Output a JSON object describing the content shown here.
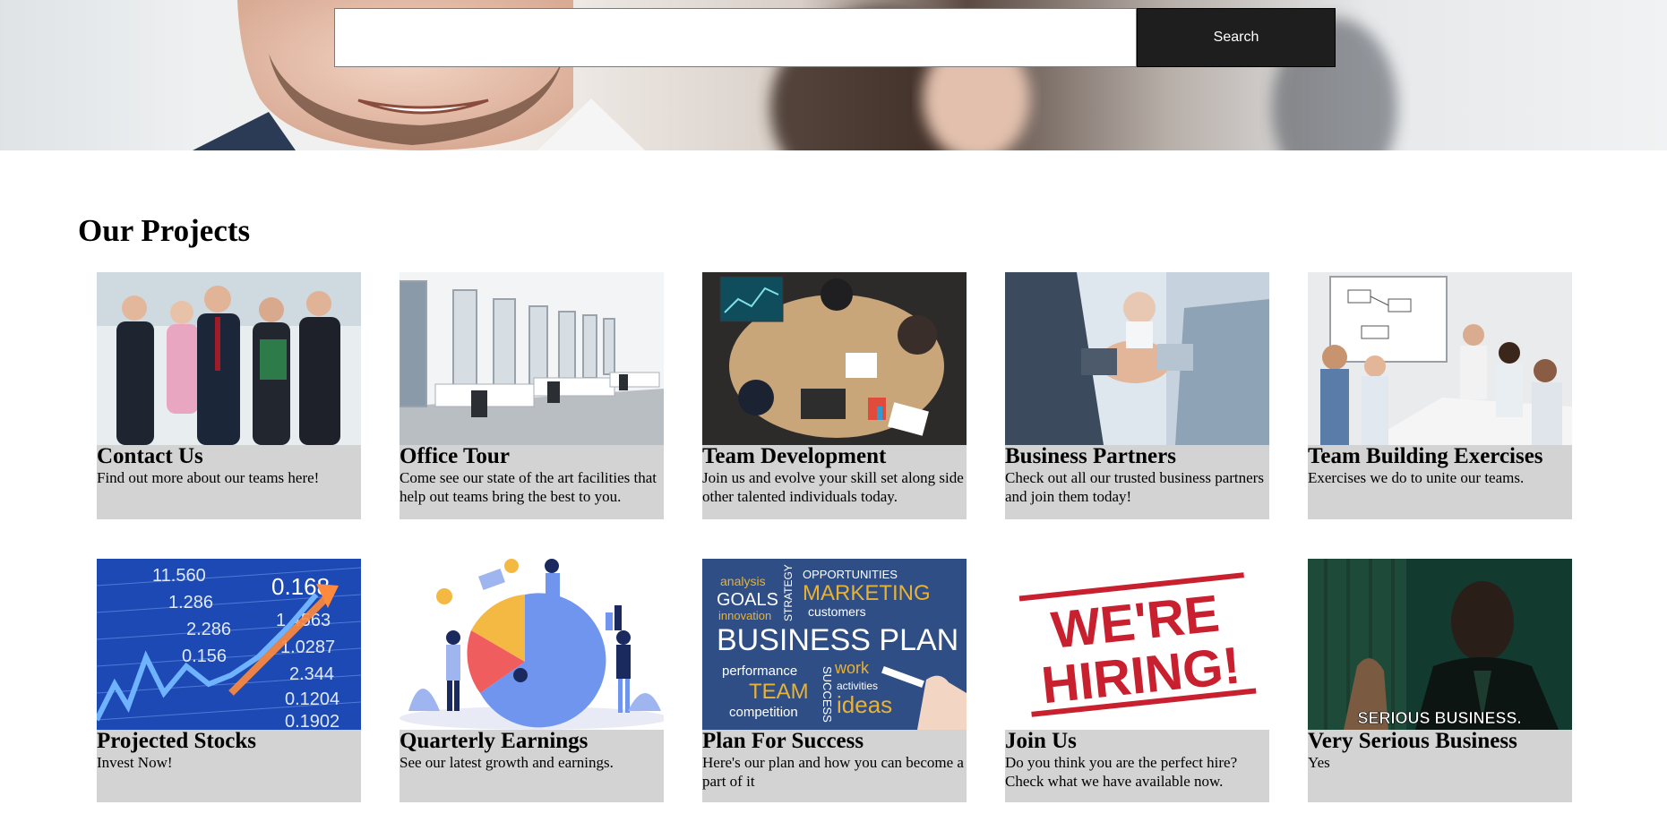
{
  "search": {
    "placeholder": "",
    "value": "",
    "button_label": "Search"
  },
  "section": {
    "title": "Our Projects"
  },
  "cards": [
    {
      "title": "Contact Us",
      "description": "Find out more about our teams here!",
      "image": "business-team-photo"
    },
    {
      "title": "Office Tour",
      "description": "Come see our state of the art facilities that help out teams bring the best to you.",
      "image": "office-interior-photo"
    },
    {
      "title": "Team Development",
      "description": "Join us and evolve your skill set along side other talented individuals today.",
      "image": "team-meeting-photo"
    },
    {
      "title": "Business Partners",
      "description": "Check out all our trusted business partners and join them today!",
      "image": "handshake-photo"
    },
    {
      "title": "Team Building Exercises",
      "description": "Exercises we do to unite our teams.",
      "image": "conference-room-photo"
    },
    {
      "title": "Projected Stocks",
      "description": "Invest Now!",
      "image": "stock-ticker-photo",
      "image_text": [
        "11.560",
        "1.286",
        "2.286",
        "0.156",
        "1.4563",
        "1.0287",
        "2.344",
        "0.1204",
        "0.1902",
        "0.168"
      ]
    },
    {
      "title": "Quarterly Earnings",
      "description": "See our latest growth and earnings.",
      "image": "earnings-illustration"
    },
    {
      "title": "Plan For Success",
      "description": "Here's our plan and how you can become a part of it",
      "image": "business-plan-chalkboard",
      "image_text": [
        "analysis",
        "GOALS",
        "innovation",
        "STRATEGY",
        "OPPORTUNITIES",
        "MARKETING",
        "customers",
        "BUSINESS PLAN",
        "performance",
        "TEAM",
        "SUCCESS",
        "work",
        "activities",
        "competition",
        "ideas"
      ]
    },
    {
      "title": "Join Us",
      "description": "Do you think you are the perfect hire? Check what we have available now.",
      "image": "hiring-stamp",
      "image_text": [
        "WE'RE",
        "HIRING!"
      ]
    },
    {
      "title": "Very Serious Business",
      "description": "Yes",
      "image": "serious-business-meme",
      "image_text": [
        "SERIOUS BUSINESS."
      ]
    }
  ],
  "colors": {
    "card_background": "#d3d3d3",
    "search_button": "#1e1e1e",
    "hiring_red": "#c8202f",
    "plan_blue": "#2f4e86",
    "plan_gold": "#e9b232",
    "stock_blue": "#1d49b4"
  }
}
